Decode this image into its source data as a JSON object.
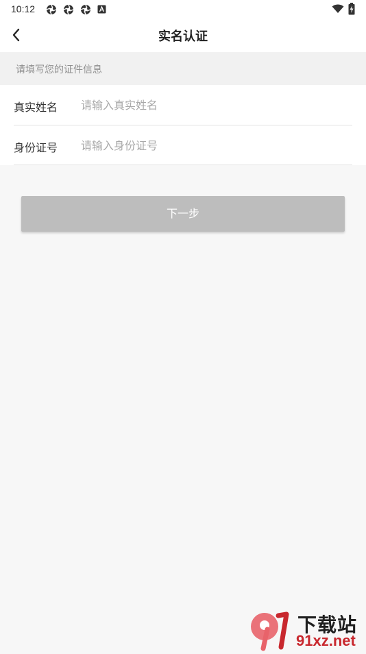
{
  "status_bar": {
    "time": "10:12",
    "notification_icons": [
      "aperture-icon",
      "aperture-icon",
      "aperture-icon",
      "a-badge-icon"
    ],
    "right_icons": [
      "wifi-icon",
      "battery-charging-icon"
    ]
  },
  "header": {
    "back_icon": "chevron-left-icon",
    "title": "实名认证"
  },
  "hint": "请填写您的证件信息",
  "form": {
    "name_label": "真实姓名",
    "name_placeholder": "请输入真实姓名",
    "name_value": "",
    "id_label": "身份证号",
    "id_placeholder": "请输入身份证号",
    "id_value": ""
  },
  "next_button": "下一步",
  "watermark": {
    "brand": "下载站",
    "url": "91xz.net"
  },
  "colors": {
    "button_disabled": "#bdbdbd",
    "hint_bg": "#f1f1f1",
    "page_bg": "#f7f7f7",
    "watermark_red": "#c8282e"
  }
}
